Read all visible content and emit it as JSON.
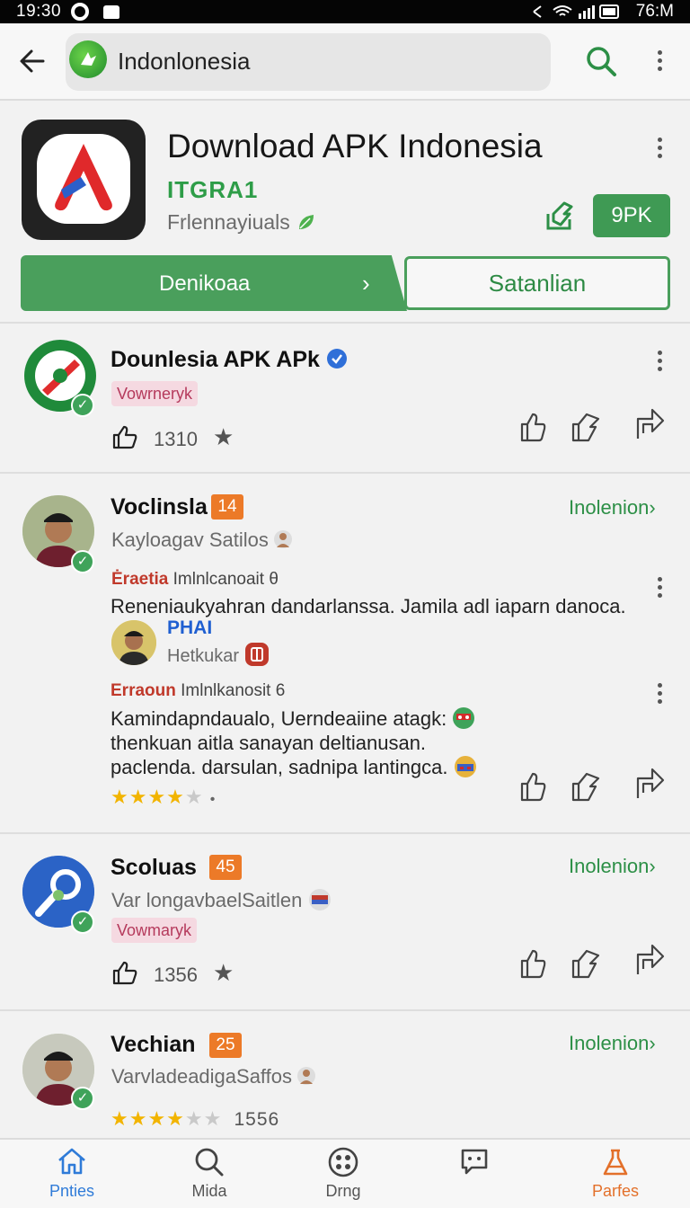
{
  "status_bar": {
    "time": "19:30",
    "right_time": "76:M"
  },
  "search": {
    "query": "Indonlonesia"
  },
  "app": {
    "title": "Download APK Indonesia",
    "developer": "ITGRA1",
    "subtitle": "Frlennayiuals",
    "size_label": "9PK",
    "primary_button": "Denikoaa",
    "secondary_button": "Satanlian"
  },
  "feed": {
    "post1": {
      "name": "Dounlesia APK APk",
      "chip": "Vowrneryk",
      "likes": "1310"
    },
    "review1": {
      "name": "Voclinsla",
      "badge": "14",
      "link": "Inolenion",
      "handle": "Kayloagav Satilos",
      "meta_red": "Ėraetia",
      "meta_rest": "Imlnlcanoait",
      "meta_num": "θ",
      "text": "Reneniaukyahran dandarlanssa. Jamila adl iaparn danoca.",
      "reply": {
        "name": "PHAI",
        "handle": "Hetkukar",
        "meta_red": "Erraoun",
        "meta_rest": "Imlnlkanosit",
        "meta_num": "6",
        "line1": "Kamindapndaualo, Uerndeaiine atagk:",
        "line2": "thenkuan aitla sanayan deltianusan.",
        "line3": "paclenda. darsulan, sadnipa lantingca.",
        "stars_filled": "★★★★",
        "stars_empty": "★",
        "stars_dot": "•"
      }
    },
    "post2": {
      "name": "Scoluas",
      "badge": "45",
      "link": "Inolenion",
      "handle": "Var longavbaelSaitlen",
      "chip": "Vowmaryk",
      "likes": "1356"
    },
    "post3": {
      "name": "Vechian",
      "badge": "25",
      "link": "Inolenion",
      "handle": "VarvladeadigaSaffos",
      "stars_filled": "★★★★",
      "stars_empty": "★★",
      "rating": "1556"
    }
  },
  "bottom_nav": {
    "item1": "Pnties",
    "item2": "Mida",
    "item3": "Drng",
    "item4": "",
    "item5": "Parfes"
  },
  "colors": {
    "accent_green": "#4a9f5c",
    "badge_orange": "#ec7a28",
    "nav_active_blue": "#2f7bd8",
    "nav_active_orange": "#e3702a"
  }
}
